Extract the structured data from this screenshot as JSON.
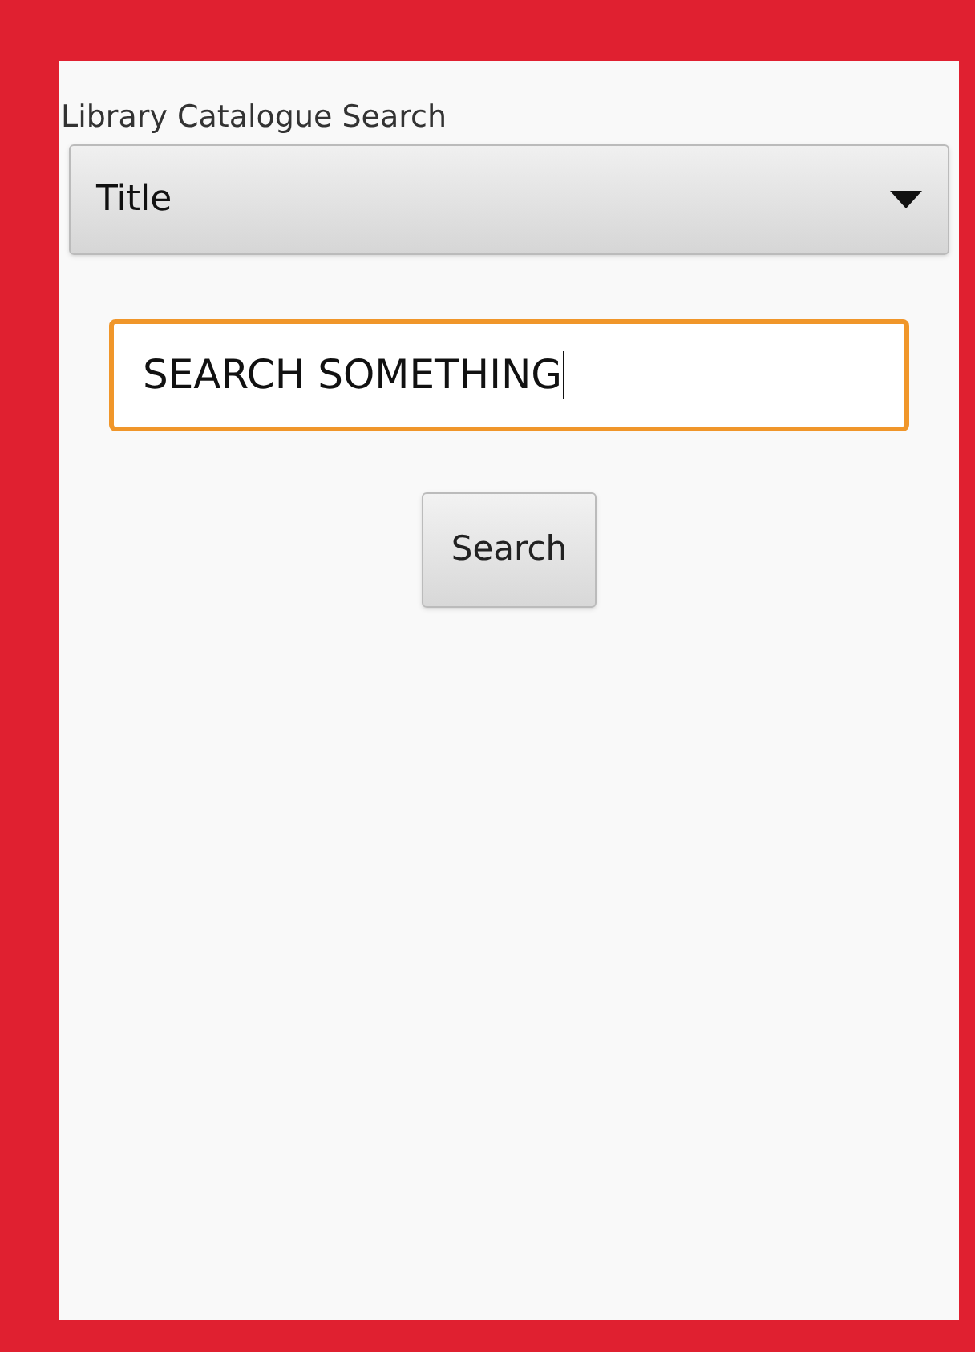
{
  "title": "Library Catalogue Search",
  "dropdown": {
    "value": "Title"
  },
  "search_field": {
    "value": "SEARCH SOMETHING",
    "focused": true
  },
  "button": {
    "label": "Search"
  }
}
